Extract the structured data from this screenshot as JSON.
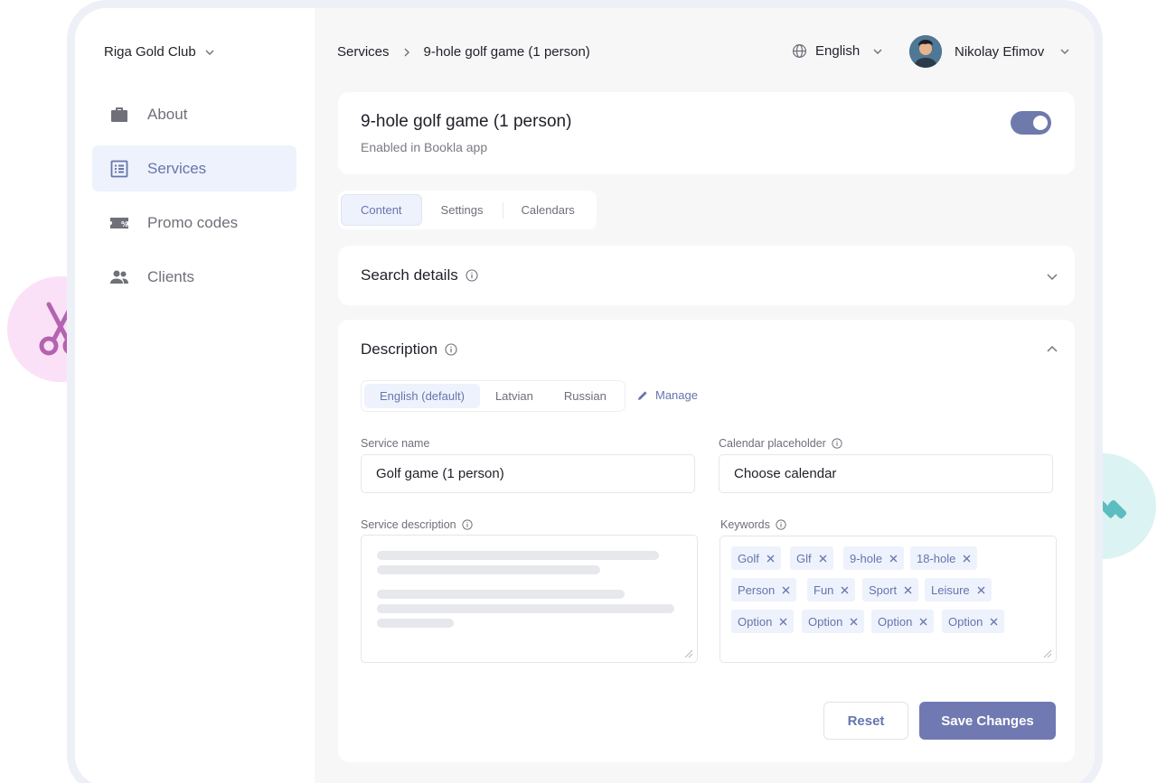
{
  "sidebar": {
    "club_name": "Riga Gold Club",
    "items": [
      {
        "label": "About",
        "icon": "briefcase-icon"
      },
      {
        "label": "Services",
        "icon": "list-icon"
      },
      {
        "label": "Promo codes",
        "icon": "ticket-percent-icon"
      },
      {
        "label": "Clients",
        "icon": "people-icon"
      }
    ],
    "active_item": "Services"
  },
  "topbar": {
    "breadcrumb": [
      "Services",
      "9-hole golf game (1 person)"
    ],
    "language": "English",
    "user_name": "Nikolay Efimov"
  },
  "service": {
    "title": "9-hole golf game (1 person)",
    "subtitle": "Enabled in Bookla app",
    "enabled": true
  },
  "tabs": [
    "Content",
    "Settings",
    "Calendars"
  ],
  "active_tab": "Content",
  "search_details": {
    "title": "Search details"
  },
  "description": {
    "title": "Description",
    "languages": [
      "English (default)",
      "Latvian",
      "Russian"
    ],
    "manage_label": "Manage",
    "service_name_label": "Service name",
    "service_name_value": "Golf game (1 person)",
    "calendar_label": "Calendar placeholder",
    "calendar_value": "Choose calendar",
    "service_desc_label": "Service description",
    "keywords_label": "Keywords",
    "keywords": [
      "Golf",
      "Glf",
      "9-hole",
      "18-hole",
      "Person",
      "Fun",
      "Sport",
      "Leisure",
      "Option",
      "Option",
      "Option",
      "Option"
    ],
    "reset_label": "Reset",
    "save_label": "Save Changes"
  },
  "colors": {
    "accent": "#6675ad",
    "accent_bg": "#eef2fc",
    "primary_button": "#7079b1",
    "pink_bubble": "#fbe1f7",
    "teal_bubble": "#dbf3f3"
  }
}
